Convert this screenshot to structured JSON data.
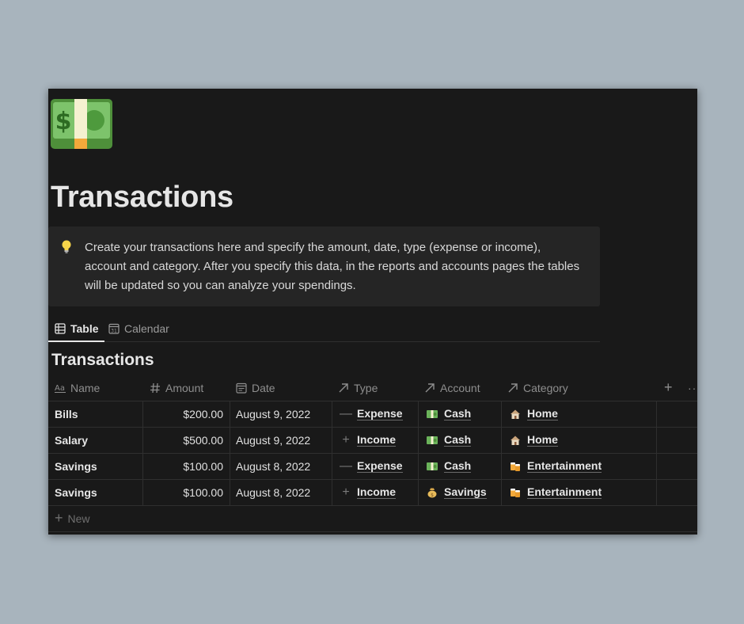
{
  "page": {
    "title": "Transactions",
    "icon": "money-banknote-icon",
    "callout": {
      "icon": "lightbulb-icon",
      "text": "Create your transactions here and specify the amount, date, type (expense or income), account and category. After you specify this data, in the reports and accounts pages the tables will be updated so you can analyze your spendings."
    }
  },
  "views": [
    {
      "label": "Table",
      "icon": "table-icon",
      "active": true
    },
    {
      "label": "Calendar",
      "icon": "calendar-icon",
      "active": false
    }
  ],
  "database": {
    "title": "Transactions",
    "columns": [
      {
        "label": "Name",
        "icon": "text-property-icon"
      },
      {
        "label": "Amount",
        "icon": "hash-icon"
      },
      {
        "label": "Date",
        "icon": "calendar-property-icon"
      },
      {
        "label": "Type",
        "icon": "relation-arrow-icon"
      },
      {
        "label": "Account",
        "icon": "relation-arrow-icon"
      },
      {
        "label": "Category",
        "icon": "relation-arrow-icon"
      }
    ],
    "add_column_label": "+",
    "more_label": "··",
    "rows": [
      {
        "name": "Bills",
        "amount": "$200.00",
        "date": "August 9, 2022",
        "type": "Expense",
        "type_icon": "minus-icon",
        "account": "Cash",
        "account_icon": "dollar-banknote-icon",
        "category": "Home",
        "category_icon": "house-icon"
      },
      {
        "name": "Salary",
        "amount": "$500.00",
        "date": "August 9, 2022",
        "type": "Income",
        "type_icon": "plus-icon",
        "account": "Cash",
        "account_icon": "dollar-banknote-icon",
        "category": "Home",
        "category_icon": "house-icon"
      },
      {
        "name": "Savings",
        "amount": "$100.00",
        "date": "August 8, 2022",
        "type": "Expense",
        "type_icon": "minus-icon",
        "account": "Cash",
        "account_icon": "dollar-banknote-icon",
        "category": "Entertainment",
        "category_icon": "beer-mugs-icon"
      },
      {
        "name": "Savings",
        "amount": "$100.00",
        "date": "August 8, 2022",
        "type": "Income",
        "type_icon": "plus-icon",
        "account": "Savings",
        "account_icon": "money-bag-icon",
        "category": "Entertainment",
        "category_icon": "beer-mugs-icon"
      }
    ],
    "new_label": "New"
  },
  "colors": {
    "background": "#191919",
    "callout_bg": "#252525",
    "text": "#e6e6e6",
    "muted": "#8e8e8e",
    "border": "#2f2f2f"
  }
}
